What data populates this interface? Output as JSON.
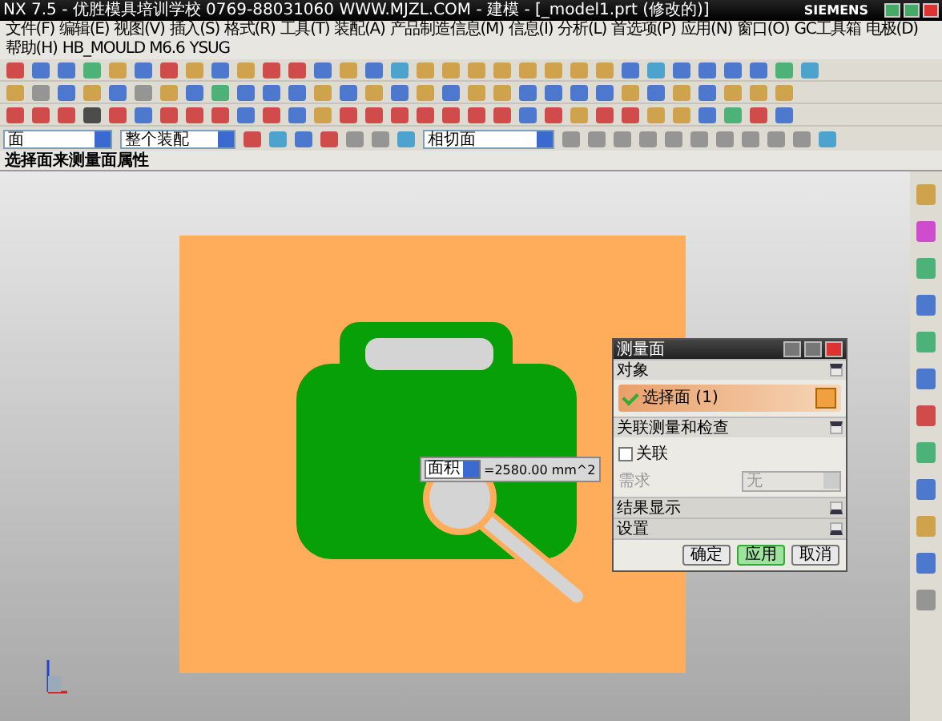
{
  "window": {
    "title": "NX 7.5 - 优胜模具培训学校 0769-88031060 WWW.MJZL.COM - 建模 - [_model1.prt (修改的)]",
    "brand": "SIEMENS"
  },
  "menu": [
    "文件(F)",
    "编辑(E)",
    "视图(V)",
    "插入(S)",
    "格式(R)",
    "工具(T)",
    "装配(A)",
    "产品制造信息(M)",
    "信息(I)",
    "分析(L)",
    "首选项(P)",
    "应用(N)",
    "窗口(O)",
    "GC工具箱",
    "电极(D)",
    "帮助(H)",
    "HB_MOULD M6.6",
    "YSUG"
  ],
  "selection_bar": {
    "filter": "面",
    "scope": "整个装配",
    "rule": "相切面"
  },
  "status_bar": {
    "prompt": "选择面来测量面属性"
  },
  "measurement_label": {
    "type": "面积",
    "value": "=2580.00 mm^2"
  },
  "dialog": {
    "title": "测量面",
    "sections": [
      {
        "kind": "select",
        "title": "对象",
        "expanded": true,
        "item": "选择面 (1)",
        "done": true
      },
      {
        "kind": "options",
        "title": "关联测量和检查",
        "expanded": true,
        "checkbox": {
          "label": "关联",
          "checked": false
        },
        "field": {
          "label": "需求",
          "value": "无",
          "disabled": true
        }
      },
      {
        "kind": "plain",
        "title": "结果显示",
        "expanded": false
      },
      {
        "kind": "plain",
        "title": "设置",
        "expanded": false
      }
    ],
    "buttons": [
      {
        "label": "确定",
        "default": false
      },
      {
        "label": "应用",
        "default": true
      },
      {
        "label": "取消",
        "default": false
      }
    ]
  }
}
